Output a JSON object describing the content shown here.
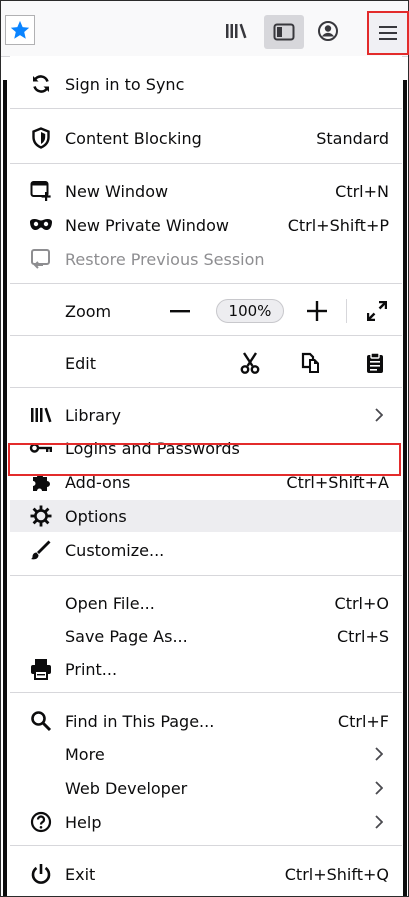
{
  "toolbar": {
    "icons": [
      "star-icon",
      "library-icon",
      "sidebar-icon",
      "account-icon",
      "hamburger-menu-icon"
    ]
  },
  "menu": {
    "sync": {
      "label": "Sign in to Sync"
    },
    "content_blocking": {
      "label": "Content Blocking",
      "value": "Standard"
    },
    "new_window": {
      "label": "New Window",
      "shortcut": "Ctrl+N"
    },
    "new_private_window": {
      "label": "New Private Window",
      "shortcut": "Ctrl+Shift+P"
    },
    "restore_session": {
      "label": "Restore Previous Session"
    },
    "zoom": {
      "label": "Zoom",
      "minus": "—",
      "value": "100%",
      "plus": "+"
    },
    "edit": {
      "label": "Edit"
    },
    "library": {
      "label": "Library"
    },
    "logins": {
      "label": "Logins and Passwords"
    },
    "addons": {
      "label": "Add-ons",
      "shortcut": "Ctrl+Shift+A"
    },
    "options": {
      "label": "Options"
    },
    "customize": {
      "label": "Customize..."
    },
    "open_file": {
      "label": "Open File...",
      "shortcut": "Ctrl+O"
    },
    "save_page": {
      "label": "Save Page As...",
      "shortcut": "Ctrl+S"
    },
    "print": {
      "label": "Print..."
    },
    "find": {
      "label": "Find in This Page...",
      "shortcut": "Ctrl+F"
    },
    "more": {
      "label": "More"
    },
    "web_developer": {
      "label": "Web Developer"
    },
    "help": {
      "label": "Help"
    },
    "exit": {
      "label": "Exit",
      "shortcut": "Ctrl+Shift+Q"
    }
  },
  "colors": {
    "highlight_border": "#e32b2b",
    "star_blue": "#0a84ff",
    "text": "#0c0c0d",
    "disabled_text": "#8e8e91"
  }
}
